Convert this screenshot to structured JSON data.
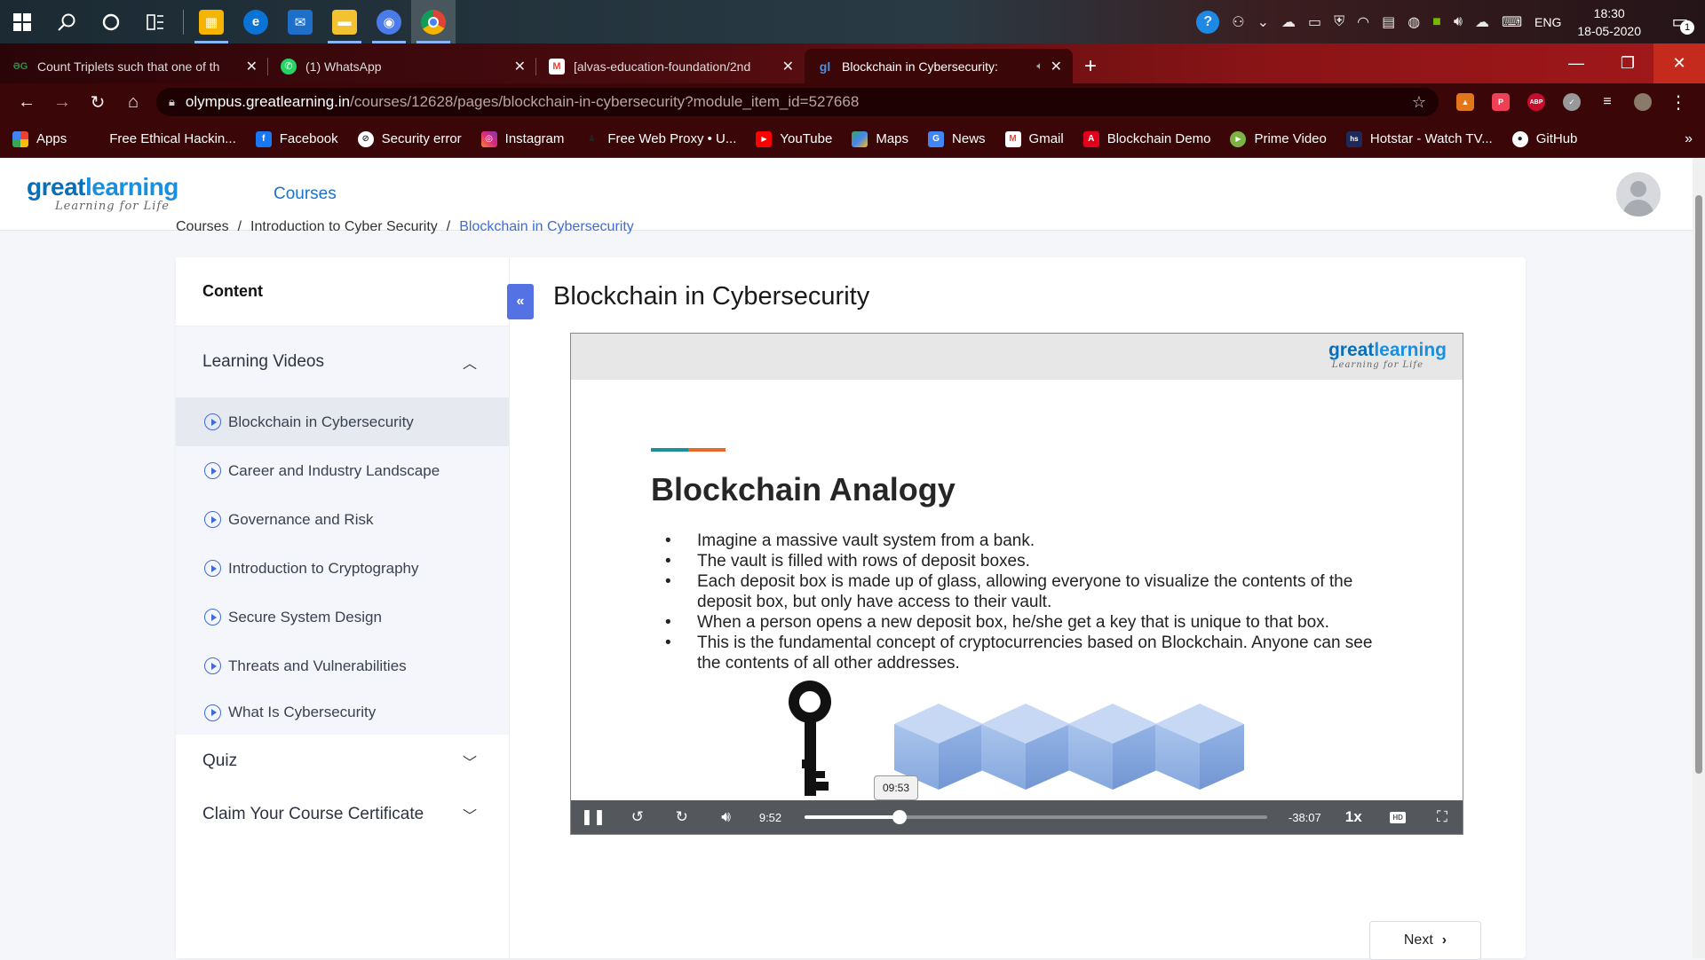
{
  "taskbar": {
    "apps": [
      {
        "name": "microsoft-store",
        "color": "#f4b400"
      },
      {
        "name": "edge",
        "color": "#0a74d6"
      },
      {
        "name": "mail",
        "color": "#1e6fc9"
      },
      {
        "name": "file-explorer",
        "color": "#f2c230"
      },
      {
        "name": "chrome-secondary",
        "color": "#4a7be8"
      },
      {
        "name": "chrome",
        "color": "#db4437"
      }
    ],
    "language": "ENG",
    "time": "18:30",
    "date": "18-05-2020",
    "notification_count": "1"
  },
  "browser": {
    "tabs": [
      {
        "favicon": "ƏG",
        "favicon_color": "#2f8d46",
        "title": "Count Triplets such that one of th",
        "active": false
      },
      {
        "favicon": "✆",
        "favicon_color": "#25d366",
        "title": "(1) WhatsApp",
        "active": false
      },
      {
        "favicon": "M",
        "favicon_color": "#ea4335",
        "title": "[alvas-education-foundation/2nd",
        "active": false
      },
      {
        "favicon": "gl",
        "favicon_color": "#1a73c9",
        "title": "Blockchain in Cybersecurity:",
        "active": true
      }
    ],
    "url_host": "olympus.greatlearning.in",
    "url_path": "/courses/12628/pages/blockchain-in-cybersecurity?module_item_id=527668",
    "extensions": [
      {
        "name": "metamask",
        "label": "🦊",
        "color": "#e2761b"
      },
      {
        "name": "pocket",
        "label": "P",
        "color": "#ef4056"
      },
      {
        "name": "adblock-plus",
        "label": "ABP",
        "color": "#c70d2c"
      },
      {
        "name": "extension-gray",
        "label": "✓",
        "color": "#888888"
      },
      {
        "name": "media-control",
        "label": "≡",
        "color": "#555555"
      },
      {
        "name": "profile",
        "label": "",
        "color": "#8a7a6a"
      }
    ]
  },
  "bookmarks": [
    {
      "label": "Apps",
      "icon": "grid-icon",
      "color": "#4285f4"
    },
    {
      "label": "Free Ethical Hackin...",
      "icon": "",
      "color": ""
    },
    {
      "label": "Facebook",
      "icon": "f",
      "color": "#1877f2"
    },
    {
      "label": "Security error",
      "icon": "⊘",
      "color": "#555555"
    },
    {
      "label": "Instagram",
      "icon": "◎",
      "color": "#c13584"
    },
    {
      "label": "Free Web Proxy • U...",
      "icon": "♟",
      "color": "#333333"
    },
    {
      "label": "YouTube",
      "icon": "▶",
      "color": "#ff0000"
    },
    {
      "label": "Maps",
      "icon": "◆",
      "color": "#34a853"
    },
    {
      "label": "News",
      "icon": "G",
      "color": "#4285f4"
    },
    {
      "label": "Gmail",
      "icon": "M",
      "color": "#ea4335"
    },
    {
      "label": "Blockchain Demo",
      "icon": "A",
      "color": "#e3001b"
    },
    {
      "label": "Prime Video",
      "icon": "▶",
      "color": "#7cb342"
    },
    {
      "label": "Hotstar - Watch TV...",
      "icon": "hs",
      "color": "#1f2a5a"
    },
    {
      "label": "GitHub",
      "icon": "●",
      "color": "#222222"
    }
  ],
  "site": {
    "logo_great": "great",
    "logo_learning": "learning",
    "logo_tagline": "Learning for Life",
    "nav_courses": "Courses",
    "breadcrumb": [
      "Courses",
      "Introduction to Cyber Security",
      "Blockchain in Cybersecurity"
    ]
  },
  "sidebar": {
    "heading": "Content",
    "sections": [
      {
        "title": "Learning Videos",
        "expanded": true,
        "items": [
          {
            "label": "Blockchain in Cybersecurity",
            "active": true
          },
          {
            "label": "Career and Industry Landscape",
            "active": false
          },
          {
            "label": "Governance and Risk",
            "active": false
          },
          {
            "label": "Introduction to Cryptography",
            "active": false
          },
          {
            "label": "Secure System Design",
            "active": false
          },
          {
            "label": "Threats and Vulnerabilities",
            "active": false
          },
          {
            "label": "What Is Cybersecurity",
            "active": false
          }
        ]
      },
      {
        "title": "Quiz",
        "expanded": false
      },
      {
        "title": "Claim Your Course Certificate",
        "expanded": false
      }
    ]
  },
  "lesson": {
    "title": "Blockchain in Cybersecurity",
    "next_label": "Next"
  },
  "video": {
    "slide_heading": "Blockchain Analogy",
    "slide_bullets": [
      "Imagine a massive vault system from a bank.",
      "The vault is filled with rows of deposit boxes.",
      "Each deposit box is made up of glass, allowing everyone to visualize the contents of the deposit box, but only have access to their vault.",
      "When a person opens a new deposit box, he/she get a key that is unique to that box.",
      "This is the fundamental concept of cryptocurrencies based on Blockchain. Anyone can see the contents of all other addresses."
    ],
    "logo_great": "great",
    "logo_learning": "learning",
    "logo_tagline": "Learning for Life",
    "current_time": "9:52",
    "remaining_time": "-38:07",
    "hover_time": "09:53",
    "progress_fraction": 0.205,
    "playback_rate": "1x",
    "hd_label": "HD"
  },
  "colors": {
    "accent_blue": "#5472e4",
    "link_blue": "#1a73c9",
    "brand_dark": "#0b6fb8",
    "chrome_theme": "#3a0608"
  }
}
